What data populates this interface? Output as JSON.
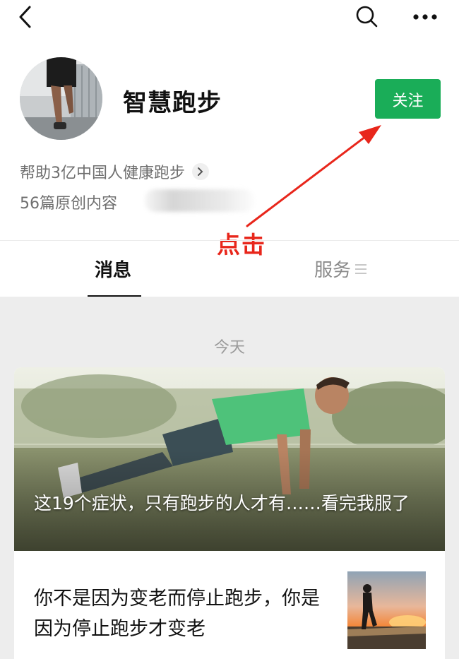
{
  "account": {
    "name": "智慧跑步",
    "description": "帮助3亿中国人健康跑步",
    "article_count": "56篇原创内容",
    "follow_label": "关注"
  },
  "annotation": {
    "text": "点击",
    "color": "#e8261b"
  },
  "tabs": [
    {
      "label": "消息",
      "active": true
    },
    {
      "label": "服务",
      "active": false
    }
  ],
  "feed": {
    "date_label": "今天",
    "articles": [
      {
        "title": "这19个症状，只有跑步的人才有……看完我服了"
      },
      {
        "title": "你不是因为变老而停止跑步，你是因为停止跑步才变老"
      }
    ]
  },
  "icons": [
    "back-arrow-icon",
    "search-icon",
    "more-icon",
    "chevron-right-icon",
    "menu-icon"
  ],
  "colors": {
    "accent_green": "#1aad58",
    "annotation_red": "#e8261b",
    "feed_bg": "#ededed"
  }
}
